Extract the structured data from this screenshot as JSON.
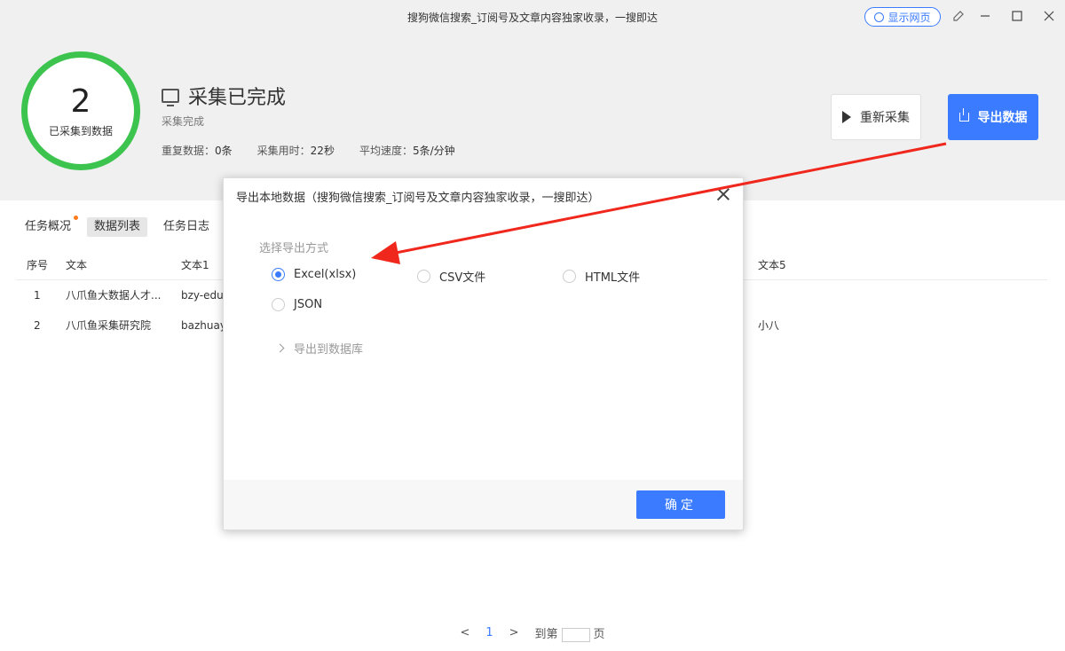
{
  "window": {
    "title": "搜狗微信搜索_订阅号及文章内容独家收录，一搜即达",
    "show_web_label": "显示网页"
  },
  "summary": {
    "count": "2",
    "count_label": "已采集到数据",
    "status_title": "采集已完成",
    "status_sub": "采集完成",
    "dup_label": "重复数据：",
    "dup_value": "0条",
    "time_label": "采集用时：",
    "time_value": "22秒",
    "speed_label": "平均速度：",
    "speed_value": "5条/分钟",
    "recollect_label": "重新采集",
    "export_label": "导出数据"
  },
  "tabs": [
    {
      "label": "任务概况"
    },
    {
      "label": "数据列表"
    },
    {
      "label": "任务日志"
    }
  ],
  "table": {
    "headers": [
      "序号",
      "文本",
      "文本1",
      "文本5"
    ],
    "rows": [
      {
        "idx": "1",
        "text": "八爪鱼大数据人才...",
        "text1": "bzy-edu",
        "text5": ""
      },
      {
        "idx": "2",
        "text": "八爪鱼采集研究院",
        "text1": "bazhuayu",
        "text5": "小八"
      }
    ]
  },
  "pager": {
    "current": "1",
    "goto_label": "到第",
    "page_label": "页"
  },
  "modal": {
    "title": "导出本地数据（搜狗微信搜索_订阅号及文章内容独家收录，一搜即达）",
    "section_label": "选择导出方式",
    "options": [
      {
        "label": "Excel(xlsx)",
        "checked": true
      },
      {
        "label": "CSV文件",
        "checked": false
      },
      {
        "label": "HTML文件",
        "checked": false
      },
      {
        "label": "JSON",
        "checked": false
      }
    ],
    "db_label": "导出到数据库",
    "ok_label": "确定"
  },
  "colors": {
    "accent": "#3a7bff",
    "ring": "#3dc44f",
    "arrow": "#f0271c",
    "dot": "#ff7a1a"
  }
}
